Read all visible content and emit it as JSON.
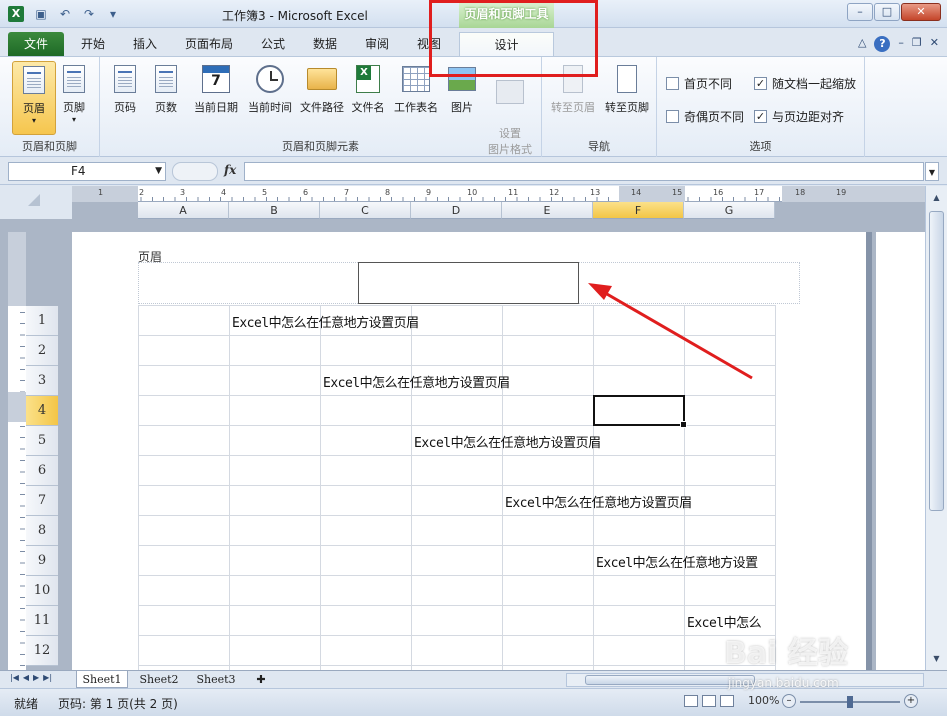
{
  "window": {
    "title": "工作簿3  -  Microsoft Excel",
    "contextual_group": "页眉和页脚工具",
    "app_icon": "X"
  },
  "tabs": [
    "文件",
    "开始",
    "插入",
    "页面布局",
    "公式",
    "数据",
    "审阅",
    "视图",
    "设计"
  ],
  "ribbon": {
    "groups": {
      "header_footer": "页眉和页脚",
      "elements": "页眉和页脚元素",
      "navigation": "导航",
      "options": "选项"
    },
    "buttons": {
      "header": "页眉",
      "footer": "页脚",
      "page_number": "页码",
      "page_count": "页数",
      "current_date": "当前日期",
      "current_time": "当前时间",
      "file_path": "文件路径",
      "file_name": "文件名",
      "sheet_name": "工作表名",
      "picture": "图片",
      "format_picture": "设置\n图片格式",
      "goto_header": "转至页眉",
      "goto_footer": "转至页脚"
    },
    "calendar_digit": "7",
    "options": {
      "first_page": {
        "label": "首页不同",
        "checked": false
      },
      "odd_even": {
        "label": "奇偶页不同",
        "checked": false
      },
      "scale_with_doc": {
        "label": "随文档一起缩放",
        "checked": true
      },
      "align_margins": {
        "label": "与页边距对齐",
        "checked": true
      }
    }
  },
  "formula_bar": {
    "name_box": "F4",
    "fx": "fx",
    "value": ""
  },
  "sheet": {
    "columns": [
      "A",
      "B",
      "C",
      "D",
      "E",
      "F",
      "G"
    ],
    "selected_column": "F",
    "rows": [
      "1",
      "2",
      "3",
      "4",
      "5",
      "6",
      "7",
      "8",
      "9",
      "10",
      "11",
      "12"
    ],
    "selected_row": "4",
    "header_label": "页眉",
    "cells": [
      {
        "text": "Excel中怎么在任意地方设置页眉"
      },
      {
        "text": "Excel中怎么在任意地方设置页眉"
      },
      {
        "text": "Excel中怎么在任意地方设置页眉"
      },
      {
        "text": "Excel中怎么在任意地方设置页眉"
      },
      {
        "text": "Excel中怎么在任意地方设置"
      },
      {
        "text": "Excel中怎么"
      }
    ],
    "ruler_numbers": [
      "1",
      "2",
      "3",
      "4",
      "5",
      "6",
      "7",
      "8",
      "9",
      "10",
      "11",
      "12",
      "13",
      "14",
      "15",
      "16",
      "17",
      "18",
      "19"
    ]
  },
  "sheet_tabs": [
    "Sheet1",
    "Sheet2",
    "Sheet3"
  ],
  "status": {
    "ready": "就绪",
    "page": "页码: 第 1 页(共 2 页)",
    "zoom": "100%"
  },
  "watermark": {
    "brand": "Bai 经验",
    "url": "jingyan.baidu.com"
  },
  "colors": {
    "highlight_red": "#e01e1e",
    "file_tab_green": "#1e6a27",
    "selected_header": "#f3c546"
  }
}
